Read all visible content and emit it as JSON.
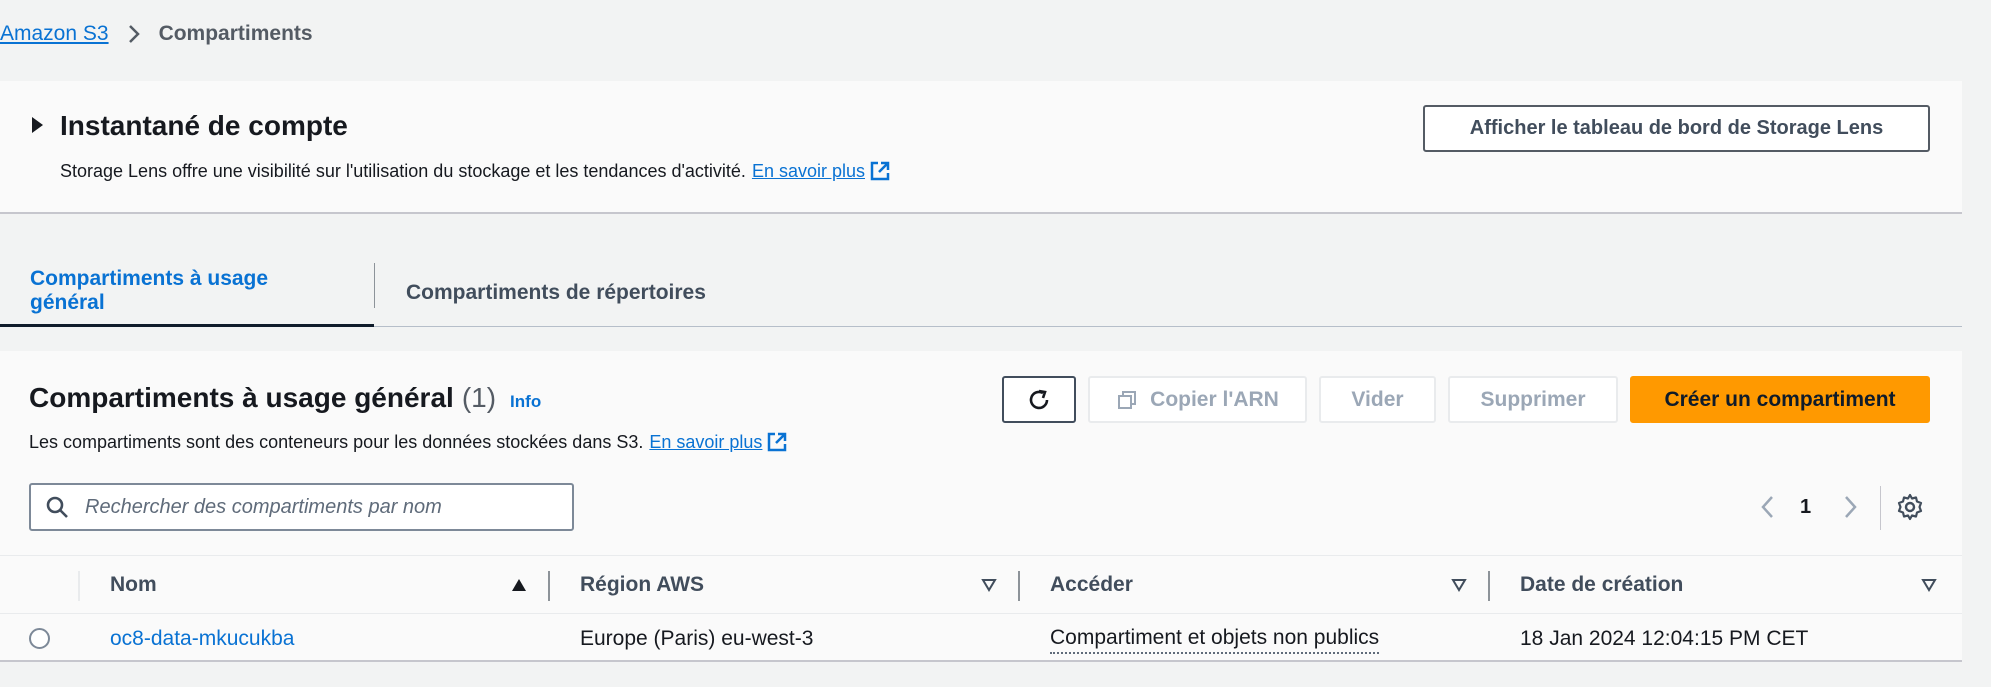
{
  "breadcrumb": {
    "root": "Amazon S3",
    "current": "Compartiments"
  },
  "snapshot": {
    "title": "Instantané de compte",
    "description": "Storage Lens offre une visibilité sur l'utilisation du stockage et les tendances d'activité.",
    "learn_more": "En savoir plus",
    "dashboard_button": "Afficher le tableau de bord de Storage Lens"
  },
  "tabs": [
    {
      "label": "Compartiments à usage général",
      "active": true
    },
    {
      "label": "Compartiments de répertoires",
      "active": false
    }
  ],
  "buckets": {
    "title": "Compartiments à usage général",
    "count": "(1)",
    "info": "Info",
    "description": "Les compartiments sont des conteneurs pour les données stockées dans S3.",
    "learn_more": "En savoir plus",
    "actions": {
      "copy_arn": "Copier l'ARN",
      "empty": "Vider",
      "delete": "Supprimer",
      "create": "Créer un compartiment"
    },
    "search_placeholder": "Rechercher des compartiments par nom",
    "page": "1",
    "columns": [
      "Nom",
      "Région AWS",
      "Accéder",
      "Date de création"
    ],
    "rows": [
      {
        "name": "oc8-data-mkucukba",
        "region": "Europe (Paris) eu-west-3",
        "access": "Compartiment et objets non publics",
        "created": "18 Jan 2024 12:04:15 PM CET"
      }
    ]
  },
  "colors": {
    "link": "#0972d3",
    "primary": "#ff9900",
    "background": "#f2f3f3"
  }
}
